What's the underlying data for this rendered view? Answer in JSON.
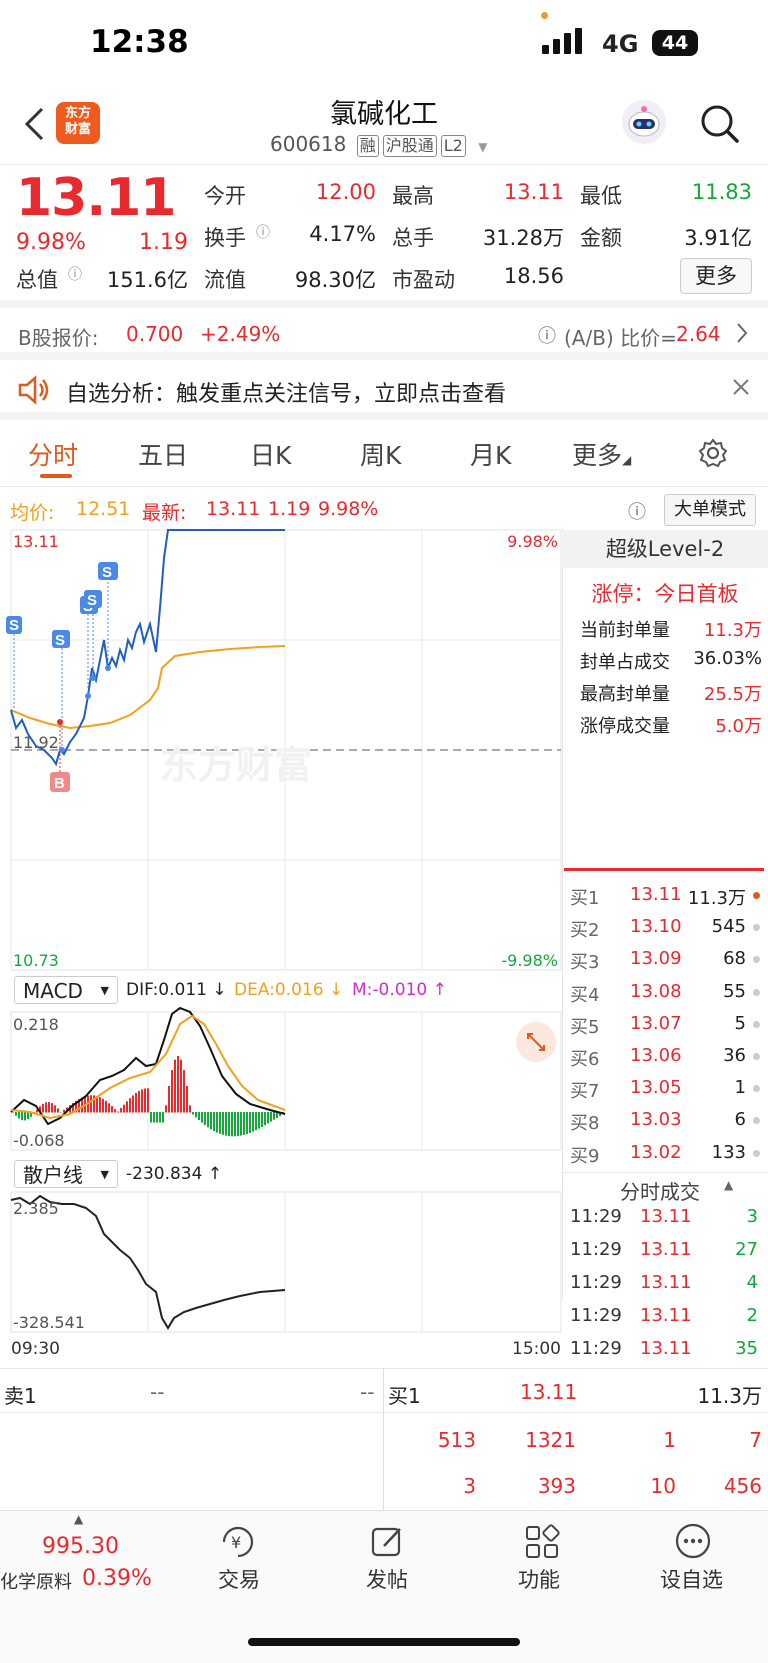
{
  "status": {
    "time": "12:38",
    "network": "4G",
    "battery": "44"
  },
  "header": {
    "logo": "东方\n财富",
    "stock_name": "氯碱化工",
    "stock_code": "600618",
    "tags": [
      "融",
      "沪股通",
      "L2"
    ]
  },
  "quote": {
    "price": "13.11",
    "pct": "9.98%",
    "change": "1.19",
    "items": [
      {
        "label": "今开",
        "value": "12.00",
        "color": "red"
      },
      {
        "label": "最高",
        "value": "13.11",
        "color": "red"
      },
      {
        "label": "最低",
        "value": "11.83",
        "color": "green"
      },
      {
        "label": "换手",
        "value": "4.17%",
        "color": "black"
      },
      {
        "label": "总手",
        "value": "31.28万",
        "color": "black"
      },
      {
        "label": "金额",
        "value": "3.91亿",
        "color": "black"
      },
      {
        "label": "总值",
        "value": "151.6亿",
        "color": "black"
      },
      {
        "label": "流值",
        "value": "98.30亿",
        "color": "black"
      },
      {
        "label": "市盈动",
        "value": "18.56",
        "color": "black"
      }
    ],
    "more": "更多"
  },
  "bshare": {
    "label": "B股报价:",
    "price": "0.700",
    "pct": "+2.49%",
    "ratio_label": "(A/B) 比价=",
    "ratio": "2.64"
  },
  "notice": {
    "text": "自选分析：触发重点关注信号，立即点击查看"
  },
  "tabs": [
    "分时",
    "五日",
    "日K",
    "周K",
    "月K",
    "更多"
  ],
  "info_line": {
    "avg_label": "均价:",
    "avg": "12.51",
    "latest_label": "最新:",
    "latest": "13.11",
    "chg": "1.19",
    "pct": "9.98%",
    "mode_btn": "大单模式"
  },
  "chart_labels": {
    "top_left": "13.11",
    "top_right": "9.98%",
    "mid": "11.92",
    "bottom_left": "10.73",
    "bottom_right": "-9.98%",
    "watermark": "东方财富",
    "time_start": "09:30",
    "time_end": "15:00",
    "marker_s": "S",
    "marker_b": "B"
  },
  "macd": {
    "selector": "MACD",
    "dif": "DIF:0.011 ↓",
    "dea": "DEA:0.016 ↓",
    "m": "M:-0.010 ↑",
    "top": "0.218",
    "bottom": "-0.068"
  },
  "retail": {
    "selector": "散户线",
    "value": "-230.834 ↑",
    "top": "2.385",
    "bottom": "-328.541"
  },
  "level2": {
    "title": "超级Level-2",
    "limit": "涨停：今日首板",
    "rows": [
      {
        "label": "当前封单量",
        "value": "11.3万"
      },
      {
        "label": "封单占成交",
        "value": "36.03%"
      },
      {
        "label": "最高封单量",
        "value": "25.5万"
      },
      {
        "label": "涨停成交量",
        "value": "5.0万"
      }
    ]
  },
  "bids": [
    {
      "label": "买1",
      "price": "13.11",
      "vol": "11.3万"
    },
    {
      "label": "买2",
      "price": "13.10",
      "vol": "545"
    },
    {
      "label": "买3",
      "price": "13.09",
      "vol": "68"
    },
    {
      "label": "买4",
      "price": "13.08",
      "vol": "55"
    },
    {
      "label": "买5",
      "price": "13.07",
      "vol": "5"
    },
    {
      "label": "买6",
      "price": "13.06",
      "vol": "36"
    },
    {
      "label": "买7",
      "price": "13.05",
      "vol": "1"
    },
    {
      "label": "买8",
      "price": "13.03",
      "vol": "6"
    },
    {
      "label": "买9",
      "price": "13.02",
      "vol": "133"
    }
  ],
  "ticks_title": "分时成交",
  "ticks": [
    {
      "time": "11:29",
      "price": "13.11",
      "vol": "3"
    },
    {
      "time": "11:29",
      "price": "13.11",
      "vol": "27"
    },
    {
      "time": "11:29",
      "price": "13.11",
      "vol": "4"
    },
    {
      "time": "11:29",
      "price": "13.11",
      "vol": "2"
    },
    {
      "time": "11:29",
      "price": "13.11",
      "vol": "35"
    }
  ],
  "queue": {
    "sell1_label": "卖1",
    "sell1_price": "--",
    "sell1_vol": "--",
    "buy1_label": "买1",
    "buy1_price": "13.11",
    "buy1_vol": "11.3万",
    "row1": [
      "513",
      "1321",
      "1",
      "7"
    ],
    "row2": [
      "3",
      "393",
      "10",
      "456"
    ]
  },
  "bottom": {
    "index_value": "995.30",
    "index_name": "化学原料",
    "index_pct": "0.39%",
    "items": [
      "交易",
      "发帖",
      "功能",
      "设自选"
    ]
  },
  "colors": {
    "red": "#e8292e",
    "green": "#14a83b",
    "orange": "#f3a01b",
    "blue": "#1f5fc4",
    "accent": "#e05a1a"
  }
}
